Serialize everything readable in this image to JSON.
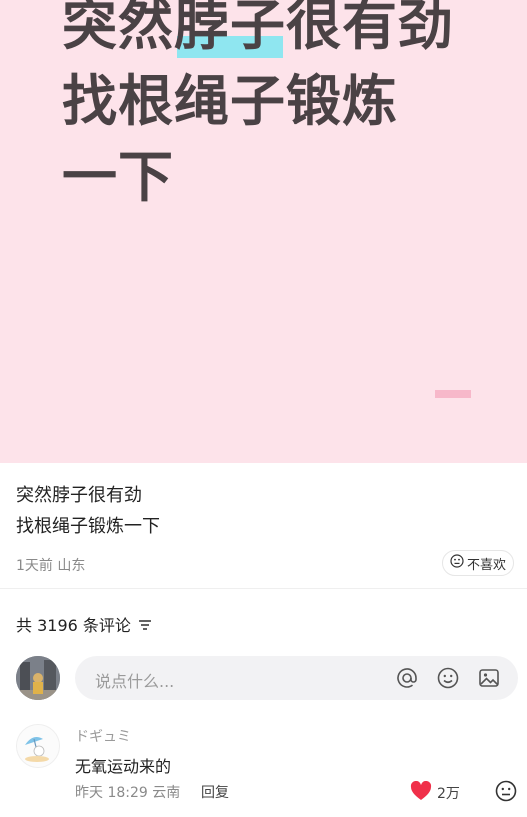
{
  "cover": {
    "line1": "突然脖子很有劲",
    "line2": "找根绳子锻炼",
    "line3": "一下",
    "highlight_color": "#8fe6f0",
    "background_color": "#fde3ea"
  },
  "caption": {
    "line1": "突然脖子很有劲",
    "line2": "找根绳子锻炼一下"
  },
  "meta": {
    "time_location": "1天前 山东",
    "dislike_label": "不喜欢",
    "dislike_icon": "sad-face-icon"
  },
  "comments_header": {
    "count_text": "共 3196 条评论",
    "sort_icon": "filter-lines-icon"
  },
  "comment_input": {
    "placeholder": "说点什么...",
    "icons": [
      "at-icon",
      "emoji-icon",
      "image-icon"
    ]
  },
  "comments": [
    {
      "author": "ドギュミ",
      "text": "无氧运动来的",
      "time_location": "昨天 18:29 云南",
      "reply_label": "回复",
      "like_count": "2万",
      "liked": true,
      "like_color": "#f0304a"
    }
  ]
}
